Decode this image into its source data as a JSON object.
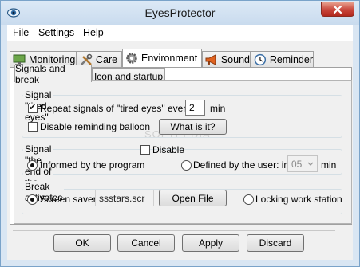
{
  "window": {
    "title": "EyesProtector"
  },
  "menu": [
    "File",
    "Settings",
    "Help"
  ],
  "tabs": [
    {
      "label": "Monitoring",
      "icon": "monitor-icon"
    },
    {
      "label": "Care",
      "icon": "tools-icon"
    },
    {
      "label": "Environment",
      "icon": "gear-icon",
      "active": true
    },
    {
      "label": "Sound",
      "icon": "megaphone-icon"
    },
    {
      "label": "Reminder",
      "icon": "clock-icon"
    }
  ],
  "subtabs": [
    {
      "label": "Signals and break",
      "active": true
    },
    {
      "label": "Icon and startup"
    }
  ],
  "signal_tired": {
    "title": "Signal \"tired eyes\"",
    "repeat_label": "Repeat signals of \"tired eyes\" every",
    "repeat_checked": true,
    "repeat_value": "2",
    "repeat_unit": "min",
    "balloon_label": "Disable reminding balloon",
    "balloon_checked": false,
    "what_button": "What is it?"
  },
  "signal_end": {
    "title": "Signal \"the end of the break\"",
    "disable_label": "Disable",
    "disable_checked": false,
    "informed_label": "Informed by the program",
    "defined_label": "Defined by the user: in",
    "selected": "informed",
    "minutes_value": "05",
    "minutes_unit": "min"
  },
  "break_activates": {
    "title": "Break activates",
    "screensaver_label": "Screen saver",
    "screensaver_value": "ssstars.scr",
    "open_file_button": "Open File",
    "locking_label": "Locking work station",
    "selected": "screensaver"
  },
  "watermark": "SOFTPEDIA",
  "buttons": {
    "ok": "OK",
    "cancel": "Cancel",
    "apply": "Apply",
    "discard": "Discard"
  }
}
